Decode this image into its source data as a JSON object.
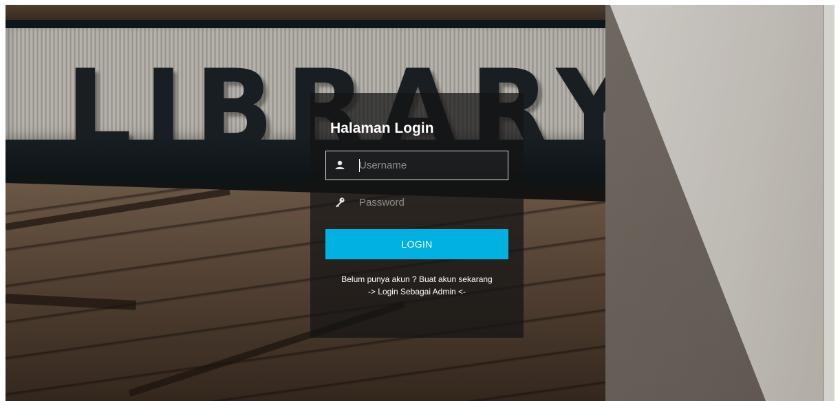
{
  "background": {
    "sign_text": "LIBRARY"
  },
  "login": {
    "title": "Halaman Login",
    "username": {
      "icon": "user-icon",
      "value": "",
      "placeholder": "Username"
    },
    "password": {
      "icon": "key-icon",
      "value": "",
      "placeholder": "Password"
    },
    "button_label": "LOGIN",
    "register_link": "Belum punya akun ? Buat akun sekarang",
    "admin_link": "-> Login Sebagai Admin <-"
  },
  "colors": {
    "button": "#00b1e1",
    "panel": "#141414",
    "text": "#ffffff",
    "placeholder": "#8f8f8f"
  }
}
